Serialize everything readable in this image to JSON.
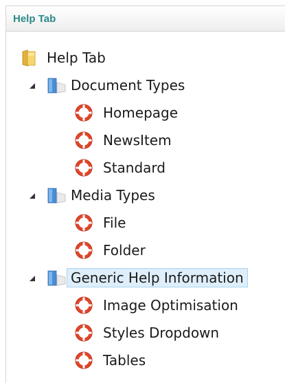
{
  "panel": {
    "title": "Help Tab"
  },
  "tree": {
    "root": {
      "label": "Help Tab",
      "icon": "folder-icon"
    },
    "document_types": {
      "label": "Document Types",
      "icon": "book-icon",
      "expanded": true,
      "children": [
        {
          "label": "Homepage",
          "icon": "lifebuoy-icon"
        },
        {
          "label": "NewsItem",
          "icon": "lifebuoy-icon"
        },
        {
          "label": "Standard",
          "icon": "lifebuoy-icon"
        }
      ]
    },
    "media_types": {
      "label": "Media Types",
      "icon": "book-icon",
      "expanded": true,
      "children": [
        {
          "label": "File",
          "icon": "lifebuoy-icon"
        },
        {
          "label": "Folder",
          "icon": "lifebuoy-icon"
        }
      ]
    },
    "generic_help": {
      "label": "Generic Help Information",
      "icon": "book-icon",
      "expanded": true,
      "selected": true,
      "children": [
        {
          "label": "Image Optimisation",
          "icon": "lifebuoy-icon"
        },
        {
          "label": "Styles Dropdown",
          "icon": "lifebuoy-icon"
        },
        {
          "label": "Tables",
          "icon": "lifebuoy-icon"
        }
      ]
    }
  },
  "colors": {
    "title": "#2b8a8a",
    "selection_bg": "#deeefa",
    "selection_border": "#a8d3f0",
    "lifebuoy": "#e0452a"
  }
}
